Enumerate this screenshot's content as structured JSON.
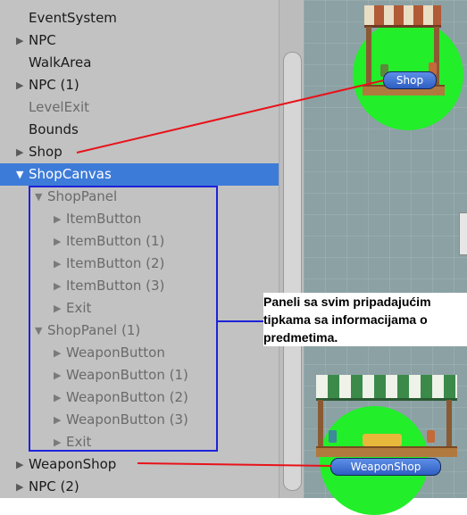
{
  "hierarchy": {
    "rows": [
      {
        "label": "EventSystem",
        "arrow": "",
        "dim": false,
        "selected": false
      },
      {
        "label": "NPC",
        "arrow": "▶",
        "dim": false,
        "selected": false
      },
      {
        "label": "WalkArea",
        "arrow": "",
        "dim": false,
        "selected": false
      },
      {
        "label": "NPC (1)",
        "arrow": "▶",
        "dim": false,
        "selected": false
      },
      {
        "label": "LevelExit",
        "arrow": "",
        "dim": true,
        "selected": false
      },
      {
        "label": "Bounds",
        "arrow": "",
        "dim": false,
        "selected": false
      },
      {
        "label": "Shop",
        "arrow": "▶",
        "dim": false,
        "selected": false
      },
      {
        "label": "ShopCanvas",
        "arrow": "▼",
        "dim": false,
        "selected": true
      },
      {
        "label": "ShopPanel",
        "arrow": "▼",
        "dim": true,
        "selected": false
      },
      {
        "label": "ItemButton",
        "arrow": "▶",
        "dim": true,
        "selected": false
      },
      {
        "label": "ItemButton (1)",
        "arrow": "▶",
        "dim": true,
        "selected": false
      },
      {
        "label": "ItemButton (2)",
        "arrow": "▶",
        "dim": true,
        "selected": false
      },
      {
        "label": "ItemButton (3)",
        "arrow": "▶",
        "dim": true,
        "selected": false
      },
      {
        "label": "Exit",
        "arrow": "▶",
        "dim": true,
        "selected": false
      },
      {
        "label": "ShopPanel (1)",
        "arrow": "▼",
        "dim": true,
        "selected": false
      },
      {
        "label": "WeaponButton",
        "arrow": "▶",
        "dim": true,
        "selected": false
      },
      {
        "label": "WeaponButton (1)",
        "arrow": "▶",
        "dim": true,
        "selected": false
      },
      {
        "label": "WeaponButton (2)",
        "arrow": "▶",
        "dim": true,
        "selected": false
      },
      {
        "label": "WeaponButton (3)",
        "arrow": "▶",
        "dim": true,
        "selected": false
      },
      {
        "label": "Exit",
        "arrow": "▶",
        "dim": true,
        "selected": false
      },
      {
        "label": "WeaponShop",
        "arrow": "▶",
        "dim": false,
        "selected": false
      },
      {
        "label": "NPC (2)",
        "arrow": "▶",
        "dim": false,
        "selected": false
      }
    ]
  },
  "scene": {
    "shop_button": "Shop",
    "weapon_shop_button": "WeaponShop"
  },
  "annotation": {
    "note": "Paneli sa svim pripadajućim\ntipkama sa informacijama o\npredmetima."
  },
  "colors": {
    "selection": "#3d7bd8",
    "highlight_box": "#1d22d8",
    "pointer_line": "#e8121a",
    "trigger_circle": "#22ee2a"
  }
}
